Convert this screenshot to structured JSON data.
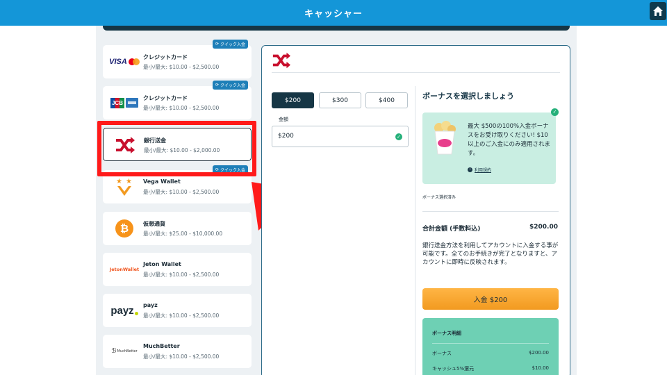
{
  "header": {
    "title": "キャッシャー"
  },
  "methods": [
    {
      "name": "クレジットカード",
      "limit": "最小/最大: $10.00 - $2,500.00",
      "quick": "クイック入金",
      "logo": "visa-mastercard"
    },
    {
      "name": "クレジットカード",
      "limit": "最小/最大: $10.00 - $2,500.00",
      "quick": "クイック入金",
      "logo": "jcb-amex"
    },
    {
      "name": "銀行送金",
      "limit": "最小/最大: $10.00 - $2,000.00",
      "logo": "bank-transfer"
    },
    {
      "name": "Vega Wallet",
      "limit": "最小/最大: $10.00 - $2,500.00",
      "quick": "クイック入金",
      "logo": "vega-wallet"
    },
    {
      "name": "仮想通貨",
      "limit": "最小/最大: $25.00 - $10,000.00",
      "logo": "bitcoin"
    },
    {
      "name": "Jeton Wallet",
      "limit": "最小/最大: $10.00 - $2,500.00",
      "logo": "jeton"
    },
    {
      "name": "payz",
      "limit": "最小/最大: $10.00 - $2,500.00",
      "logo": "payz"
    },
    {
      "name": "MuchBetter",
      "limit": "最小/最大: $10.00 - $2,500.00",
      "logo": "muchbetter"
    }
  ],
  "logos": {
    "visa": "VISA",
    "jcb": "JCB",
    "jeton": "JetonWallet",
    "payz": "payz",
    "muchbetter": "MuchBetter",
    "vega": "Vega Wallet"
  },
  "deposit": {
    "amount_options": [
      "$200",
      "$300",
      "$400"
    ],
    "selected_amount": "$200",
    "amount_label": "金額",
    "amount_value": "$200"
  },
  "bonus": {
    "title": "ボーナスを選択しましょう",
    "offer_text": "最大 $500の100%入金ボーナスをお受け取りください! $10以上のご入金にのみ適用されます。",
    "terms_link": "利用規約",
    "selected_note": "ボーナス選択済み"
  },
  "summary": {
    "total_label": "合計金額 (手数料込)",
    "total_value": "$200.00",
    "description": "銀行送金方法を利用してアカウントに入金する事が可能です。全てのお手続きが完了となりますと、アカウントに即時に反映されます。",
    "deposit_button": "入金 $200"
  },
  "breakdown": {
    "title": "ボーナス明細",
    "rows": [
      {
        "label": "ボーナス",
        "value": "$200.00"
      },
      {
        "label": "キャッシュ5%還元",
        "value": "$10.00"
      }
    ]
  },
  "colors": {
    "header_blue": "#1496d8",
    "dark_navy": "#163645",
    "highlight_red": "#ff1a1a",
    "bonus_green": "#c9eee2",
    "deposit_orange": "#f29a20"
  }
}
